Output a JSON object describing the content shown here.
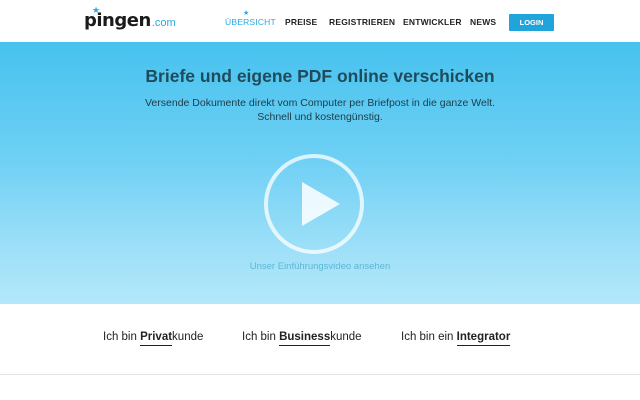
{
  "header": {
    "logo": {
      "main": "pingen",
      "tld": ".com"
    },
    "nav": [
      {
        "label": "ÜBERSICHT",
        "active": true
      },
      {
        "label": "PREISE",
        "active": false
      },
      {
        "label": "REGISTRIEREN",
        "active": false
      },
      {
        "label": "ENTWICKLER",
        "active": false
      },
      {
        "label": "NEWS",
        "active": false
      }
    ],
    "login_label": "LOGIN"
  },
  "hero": {
    "title": "Briefe und eigene PDF online verschicken",
    "subtitle_line1": "Versende Dokumente direkt vom Computer per Briefpost in die ganze Welt.",
    "subtitle_line2": "Schnell und kostengünstig.",
    "video_label": "Unser Einführungsvideo ansehen"
  },
  "segments": [
    {
      "prefix": "Ich bin ",
      "keyword": "Privat",
      "suffix": "kunde"
    },
    {
      "prefix": "Ich bin ",
      "keyword": "Business",
      "suffix": "kunde"
    },
    {
      "prefix": "Ich bin ein ",
      "keyword": "Integrator",
      "suffix": ""
    }
  ],
  "colors": {
    "accent": "#29a8e0",
    "login_bg": "#21a4d9",
    "hero_top": "#46c2ef",
    "hero_bottom": "#b3e8fa"
  },
  "icons": {
    "play": "play-icon",
    "star": "star-icon"
  }
}
